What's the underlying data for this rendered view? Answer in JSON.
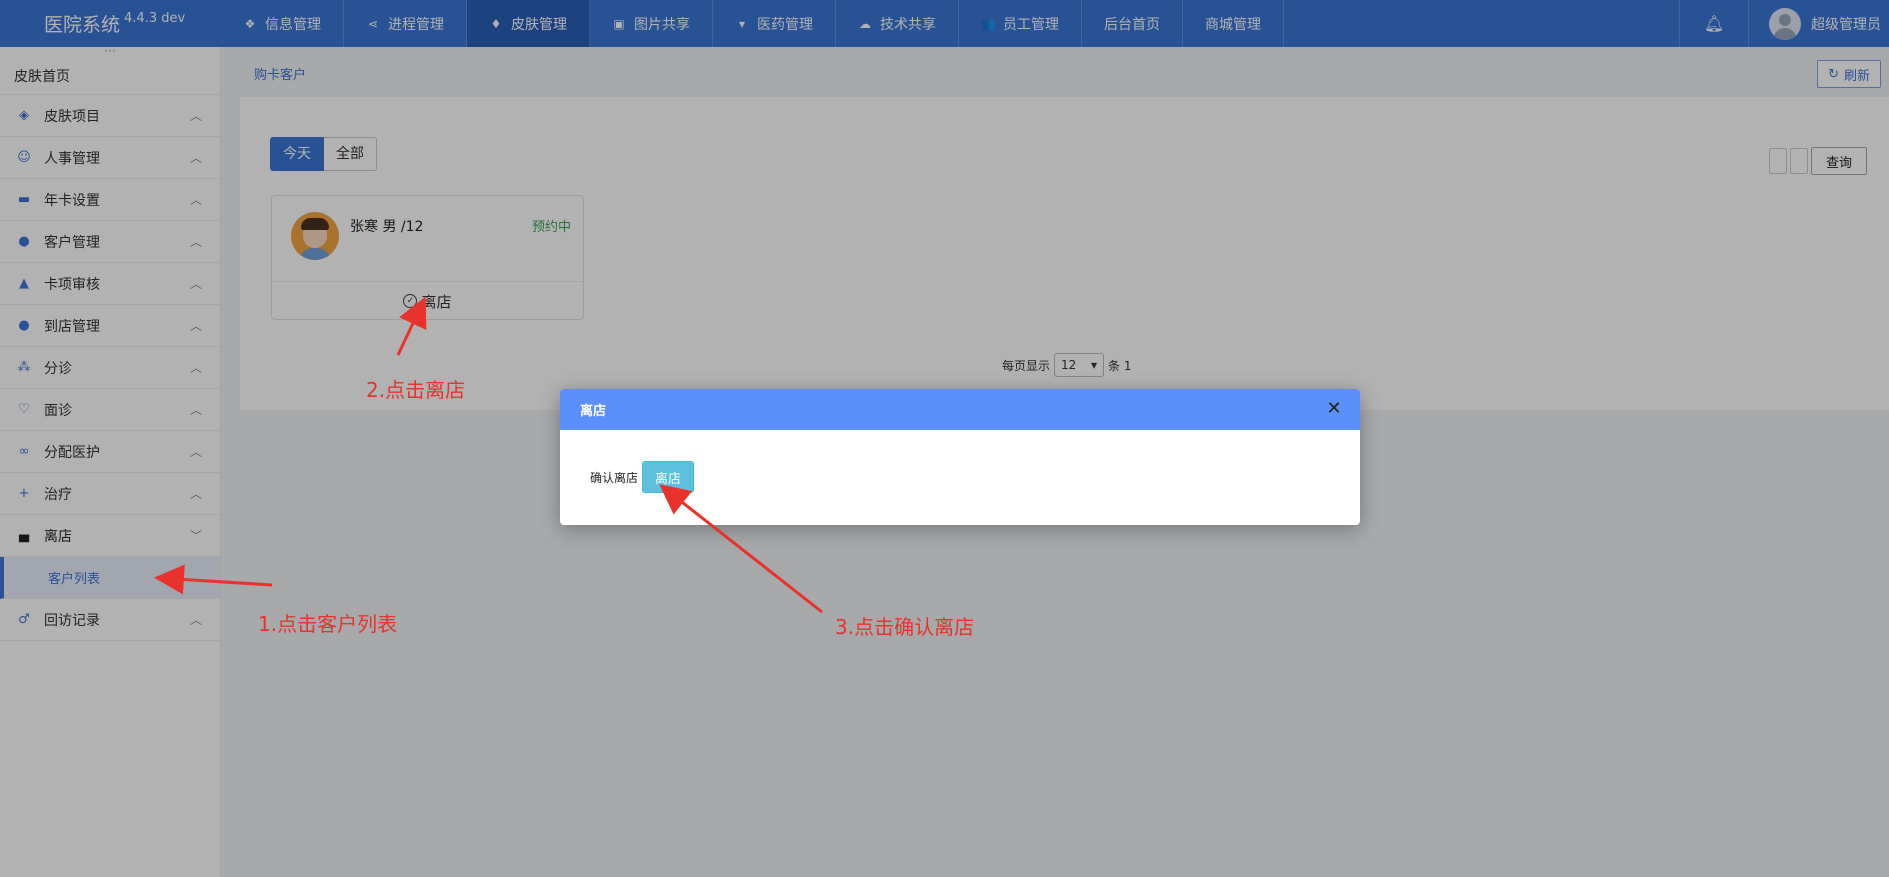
{
  "app": {
    "title": "医院系统",
    "version": "4.4.3 dev"
  },
  "topnav": [
    {
      "label": "信息管理",
      "icon": "cube-icon",
      "glyph": "❖"
    },
    {
      "label": "进程管理",
      "icon": "share-icon",
      "glyph": "⋖"
    },
    {
      "label": "皮肤管理",
      "icon": "diamond-icon",
      "glyph": "♦",
      "active": true
    },
    {
      "label": "图片共享",
      "icon": "image-icon",
      "glyph": "▣"
    },
    {
      "label": "医药管理",
      "icon": "cart-icon",
      "glyph": "▾"
    },
    {
      "label": "技术共享",
      "icon": "cloud-upload-icon",
      "glyph": "☁"
    },
    {
      "label": "员工管理",
      "icon": "users-icon",
      "glyph": "👥"
    },
    {
      "label": "后台首页"
    },
    {
      "label": "商城管理"
    }
  ],
  "user": {
    "name": "超级管理员"
  },
  "sidebar": {
    "home": "皮肤首页",
    "items": [
      {
        "label": "皮肤项目",
        "icon": "layers-icon"
      },
      {
        "label": "人事管理",
        "icon": "smile-icon"
      },
      {
        "label": "年卡设置",
        "icon": "folder-icon"
      },
      {
        "label": "客户管理",
        "icon": "user-gear-icon"
      },
      {
        "label": "卡项审核",
        "icon": "user-stamp-icon"
      },
      {
        "label": "到店管理",
        "icon": "user-gear-icon"
      },
      {
        "label": "分诊",
        "icon": "triage-icon"
      },
      {
        "label": "面诊",
        "icon": "heart-icon"
      },
      {
        "label": "分配医护",
        "icon": "link-icon"
      },
      {
        "label": "治疗",
        "icon": "plus-icon"
      },
      {
        "label": "离店",
        "icon": "car-icon",
        "open": true
      },
      {
        "label": "回访记录",
        "icon": "male-icon"
      }
    ],
    "sub": "客户列表"
  },
  "breadcrumb": "购卡客户",
  "refresh_label": "刷新",
  "filters": {
    "today": "今天",
    "all": "全部"
  },
  "query_label": "查询",
  "card": {
    "name_line": "张寒 男 /12",
    "status": "预约中",
    "action": "离店"
  },
  "pager": {
    "prefix": "每页显示",
    "size": "12",
    "suffix": "条 1"
  },
  "modal": {
    "title": "离店",
    "confirm_text": "确认离店",
    "button": "离店"
  },
  "annotations": {
    "step1": "1.点击客户列表",
    "step2": "2.点击离店",
    "step3": "3.点击确认离店",
    "color": "#e8322b"
  }
}
